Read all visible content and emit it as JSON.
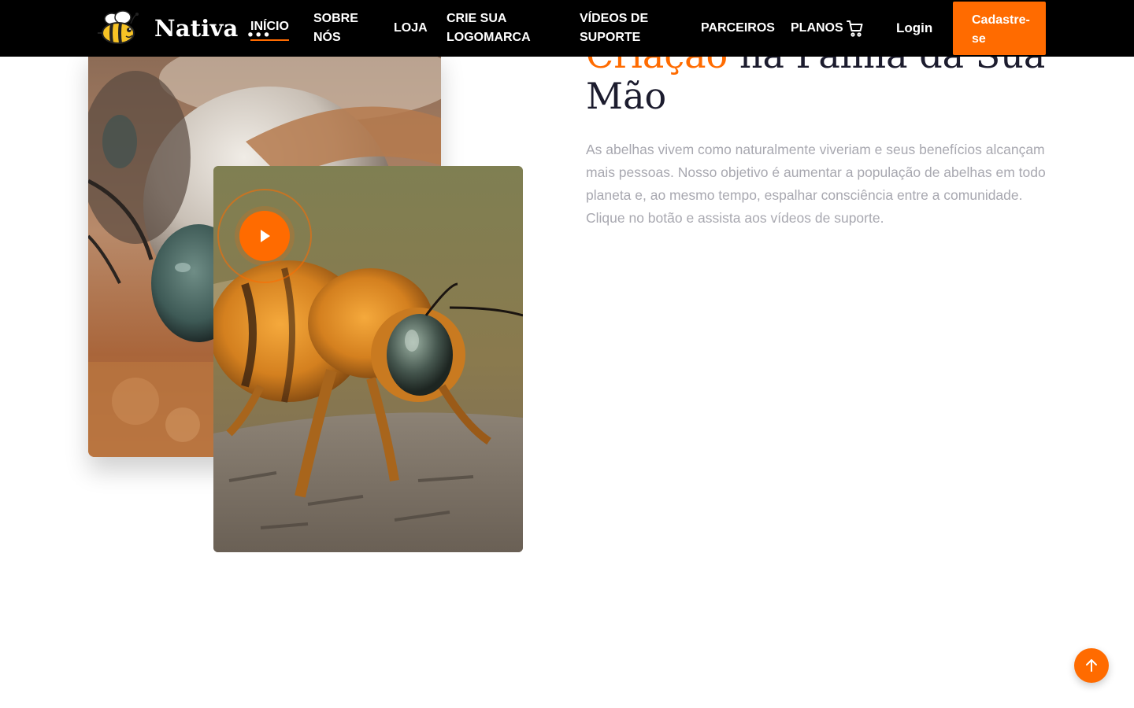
{
  "header": {
    "brand_name": "Nativa ...",
    "nav": {
      "inicio": "INÍCIO",
      "sobre_line1": "SOBRE",
      "sobre_line2": "NÓS",
      "loja": "LOJA",
      "logomarca_line1": "CRIE SUA",
      "logomarca_line2": "LOGOMARCA",
      "videos_line1": "VÍDEOS DE",
      "videos_line2": "SUPORTE",
      "parceiros": "PARCEIROS",
      "planos": "PLANOS"
    },
    "login": "Login",
    "signup_line1": "Cadastre-",
    "signup_line2": "se",
    "cart_icon": "shopping-cart-icon"
  },
  "hero": {
    "heading_accent": "Criação",
    "heading_rest": " na Palma da Sua",
    "heading_line2": "Mão",
    "description": "As abelhas vivem como naturalmente viveriam e seus benefícios alcançam mais pessoas. Nosso objetivo é aumentar a população de abelhas em todo planeta e, ao mesmo tempo, espalhar consciência entre a comunidade. Clique no botão e assista aos vídeos de suporte.",
    "play_icon": "play-icon"
  },
  "scroll_top_icon": "arrow-up-icon",
  "colors": {
    "accent": "#ff6b00",
    "header_bg": "#000000",
    "heading": "#1c1c2e",
    "body_text": "#a8a8b0"
  }
}
